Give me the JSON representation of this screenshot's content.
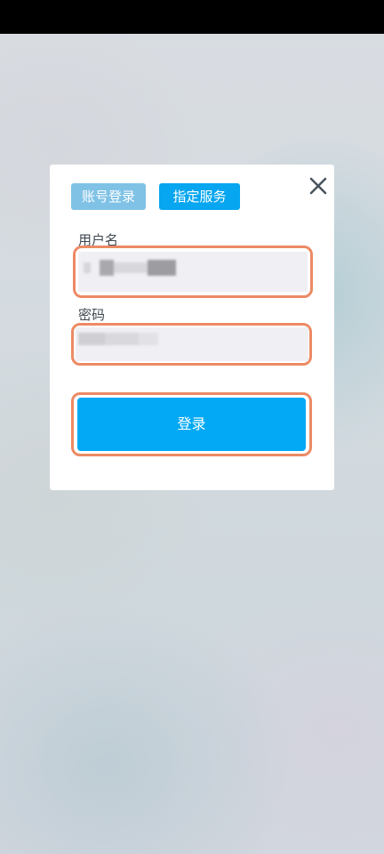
{
  "dialog": {
    "tabs": [
      {
        "label": "账号登录",
        "active": false,
        "color": "#7fc2e6"
      },
      {
        "label": "指定服务",
        "active": true,
        "color": "#06a6f0"
      }
    ],
    "close_icon": "close-icon",
    "username": {
      "label": "用户名",
      "value_obscured": true
    },
    "password": {
      "label": "密码",
      "value_obscured": true
    },
    "login_label": "登录"
  },
  "colors": {
    "status_bar": "#000000",
    "highlight": "#ec8a65",
    "primary": "#03a9f4",
    "input_bg": "#efeff4"
  }
}
